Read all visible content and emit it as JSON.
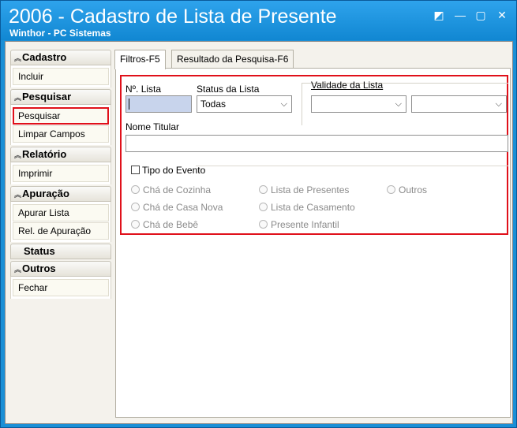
{
  "window": {
    "title": "2006 - Cadastro de Lista de Presente",
    "subtitle": "Winthor - PC Sistemas",
    "controls": [
      "◩",
      "—",
      "▢",
      "✕"
    ]
  },
  "sidebar": {
    "groups": [
      {
        "title": "Cadastro",
        "items": [
          "Incluir"
        ]
      },
      {
        "title": "Pesquisar",
        "items": [
          "Pesquisar",
          "Limpar Campos"
        ]
      },
      {
        "title": "Relatório",
        "items": [
          "Imprimir"
        ]
      },
      {
        "title": "Apuração",
        "items": [
          "Apurar Lista",
          "Rel. de Apuração"
        ]
      },
      {
        "title": "Status",
        "items": []
      },
      {
        "title": "Outros",
        "items": [
          "Fechar"
        ]
      }
    ]
  },
  "tabs": [
    "Filtros-F5",
    "Resultado da Pesquisa-F6"
  ],
  "filters": {
    "num_lista_label": "Nº. Lista",
    "num_lista_value": "",
    "status_label": "Status da Lista",
    "status_value": "Todas",
    "validade_label": "Validade da Lista",
    "validade_from": "",
    "validade_to": "",
    "nome_titular_label": "Nome Titular",
    "nome_titular_value": "",
    "tipo_evento_label": "Tipo do Evento",
    "events": [
      "Chá de Cozinha",
      "Chá de Casa Nova",
      "Chá de Bebê",
      "Lista de Presentes",
      "Lista de Casamento",
      "Presente Infantil",
      "Outros"
    ]
  }
}
